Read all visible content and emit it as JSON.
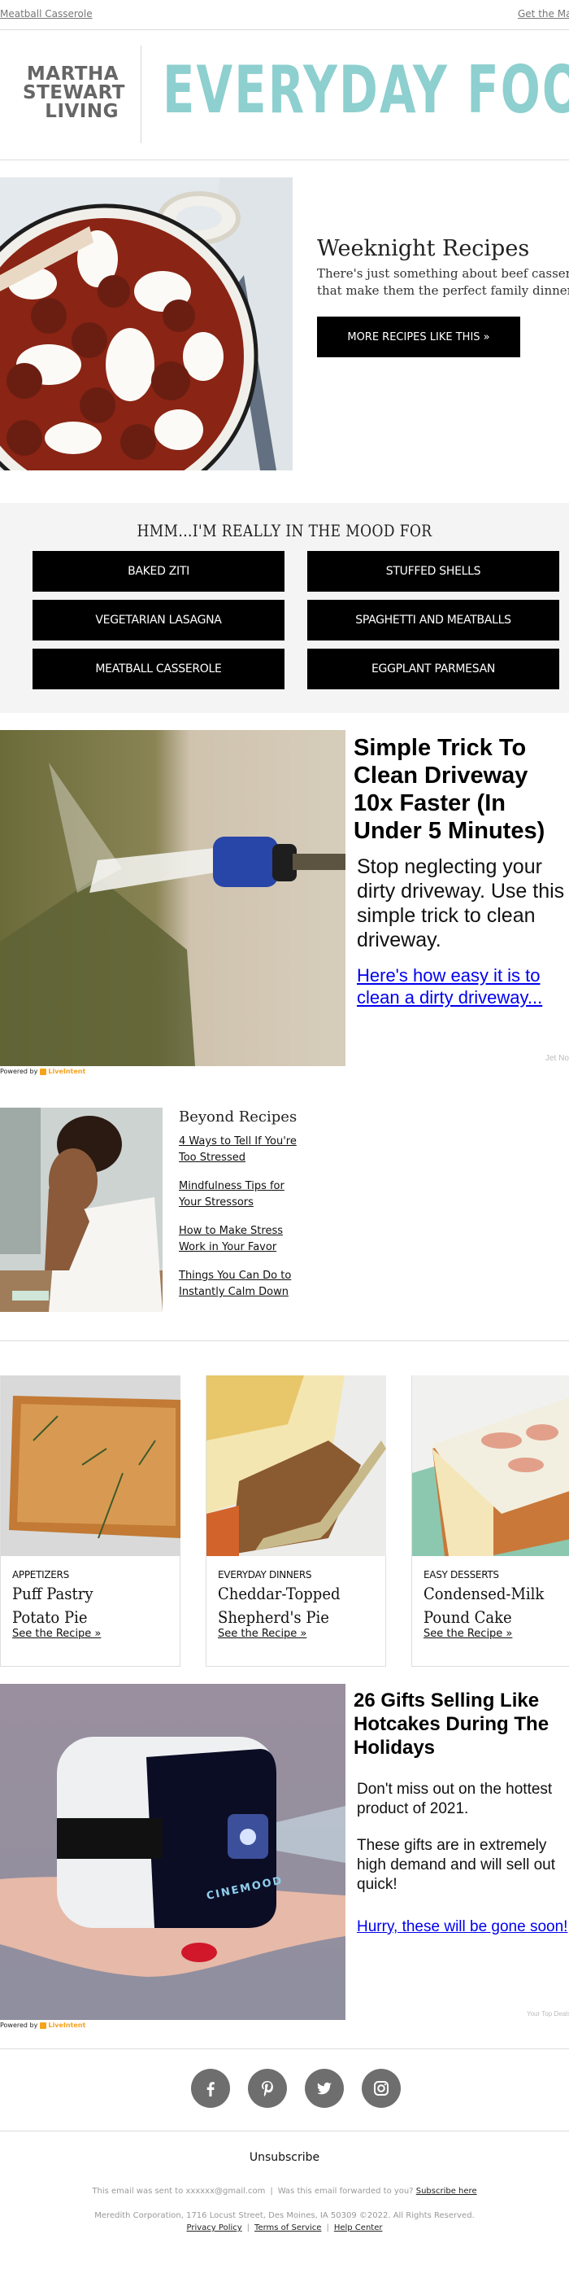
{
  "preheader": {
    "left_link": "Meatball Casserole",
    "right_link": "Get the Magazine"
  },
  "logo": {
    "brand_lines": [
      "MARTHA",
      "STEWART",
      "LIVING"
    ],
    "title": "EVERYDAY FOOD",
    "title_color": "#8ecfcf"
  },
  "hero": {
    "image_alt": "Meatball casserole in white pan",
    "title": "Weeknight Recipes",
    "description_lines": [
      "There's just something about beef casseroles",
      "that make them the perfect family dinner."
    ],
    "button_label": "MORE RECIPES LIKE THIS »"
  },
  "mood": {
    "title": "HMM...I'M REALLY IN THE MOOD FOR",
    "buttons": [
      {
        "label": "BAKED ZITI"
      },
      {
        "label": "STUFFED SHELLS"
      },
      {
        "label": "VEGETARIAN LASAGNA"
      },
      {
        "label": "SPAGHETTI AND MEATBALLS"
      },
      {
        "label": "MEATBALL CASSEROLE"
      },
      {
        "label": "EGGPLANT PARMESAN"
      }
    ]
  },
  "ad1": {
    "image_alt": "Pressure washer cleaning driveway",
    "title_lines": [
      "Simple Trick To",
      "Clean Driveway",
      "10x Faster (In",
      "Under 5 Minutes)"
    ],
    "text_lines": [
      "Stop neglecting your",
      "dirty driveway. Use this",
      "simple trick to clean",
      "driveway."
    ],
    "link_lines": [
      "Here's how easy it is to",
      "clean a dirty driveway..."
    ],
    "credit": "Jet Nozzle",
    "powered_by": "Powered by",
    "powered_brand": "LiveIntent"
  },
  "beyond": {
    "image_alt": "Stressed woman at desk",
    "title": "Beyond Recipes",
    "links": [
      {
        "lines": [
          "4 Ways to Tell If You're",
          "Too Stressed"
        ]
      },
      {
        "lines": [
          "Mindfulness Tips for",
          "Your Stressors"
        ]
      },
      {
        "lines": [
          "How to Make Stress",
          "Work in Your Favor"
        ]
      },
      {
        "lines": [
          "Things You Can Do to",
          "Instantly Calm Down"
        ]
      }
    ]
  },
  "cards": [
    {
      "category": "APPETIZERS",
      "title_lines": [
        "Puff Pastry",
        "Potato Pie"
      ],
      "link": "See the Recipe »"
    },
    {
      "category": "EVERYDAY DINNERS",
      "title_lines": [
        "Cheddar-Topped",
        "Shepherd's Pie"
      ],
      "link": "See the Recipe »"
    },
    {
      "category": "EASY DESSERTS",
      "title_lines": [
        "Condensed-Milk",
        "Pound Cake"
      ],
      "link": "See the Recipe »"
    }
  ],
  "ad2": {
    "image_alt": "Cinemood mini projector in hand",
    "image_brand_text": "CINEMOOD",
    "title_lines": [
      "26 Gifts Selling Like",
      "Hotcakes During The",
      "Holidays"
    ],
    "text1_lines": [
      "Don't miss out on the hottest",
      "product of 2021."
    ],
    "text2_lines": [
      "These gifts are in extremely",
      "high demand and will sell out",
      "quick!"
    ],
    "link": "Hurry, these will be gone soon!",
    "credit": "Your Top Deals",
    "powered_by": "Powered by",
    "powered_brand": "LiveIntent"
  },
  "social": [
    {
      "name": "facebook"
    },
    {
      "name": "pinterest"
    },
    {
      "name": "twitter"
    },
    {
      "name": "instagram"
    }
  ],
  "footer": {
    "unsubscribe": "Unsubscribe",
    "sent_to": "This email was sent to xxxxxx@gmail.com",
    "forwarded": "Was this email forwarded to you?",
    "subscribe_link": "Subscribe here",
    "address": "Meredith Corporation, 1716 Locust Street, Des Moines, IA 50309 ©2022. All Rights Reserved.",
    "links": [
      "Privacy Policy",
      "Terms of Service",
      "Help Center"
    ]
  }
}
